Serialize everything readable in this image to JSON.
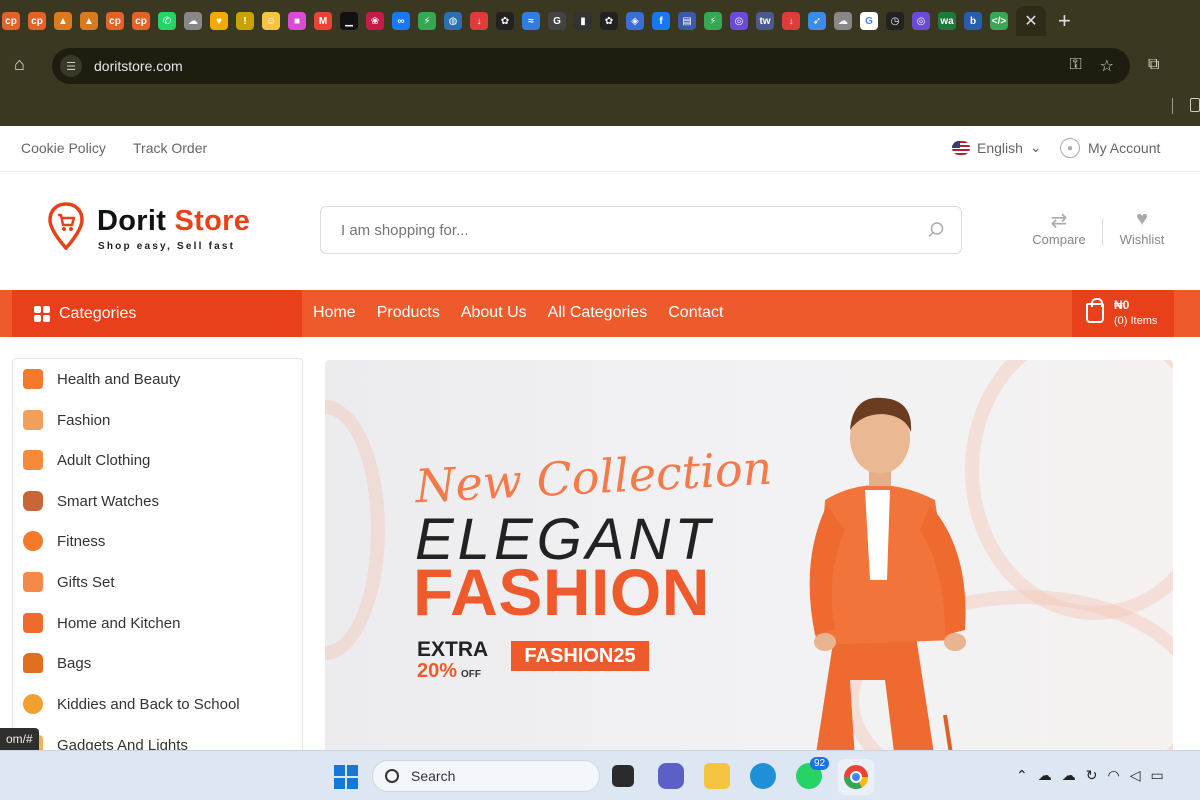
{
  "browser": {
    "active_tab_close": "✕",
    "new_tab": "+",
    "url": "doritstore.com",
    "favicons": [
      {
        "name": "cp-icon",
        "color": "#e3622a",
        "glyph": "cp"
      },
      {
        "name": "cp-icon",
        "color": "#e3622a",
        "glyph": "cp"
      },
      {
        "name": "triangle-icon",
        "color": "#d97a1e",
        "glyph": "▲"
      },
      {
        "name": "triangle-icon",
        "color": "#d97a1e",
        "glyph": "▲"
      },
      {
        "name": "cp-icon",
        "color": "#e3622a",
        "glyph": "cp"
      },
      {
        "name": "cp-icon",
        "color": "#e3622a",
        "glyph": "cp"
      },
      {
        "name": "whatsapp-icon",
        "color": "#25d366",
        "glyph": "✆"
      },
      {
        "name": "cloud-icon",
        "color": "#888",
        "glyph": "☁"
      },
      {
        "name": "heart-icon",
        "color": "#f2a900",
        "glyph": "♥"
      },
      {
        "name": "bookmark-icon",
        "color": "#c8a300",
        "glyph": "!"
      },
      {
        "name": "smile-icon",
        "color": "#f5c542",
        "glyph": "☺"
      },
      {
        "name": "grid-icon",
        "color": "#d84cd6",
        "glyph": "■"
      },
      {
        "name": "gmail-icon",
        "color": "#ea4335",
        "glyph": "M"
      },
      {
        "name": "chart-icon",
        "color": "#111",
        "glyph": "▁"
      },
      {
        "name": "raspberry-icon",
        "color": "#c51a4a",
        "glyph": "❀"
      },
      {
        "name": "meta-icon",
        "color": "#1877f2",
        "glyph": "∞"
      },
      {
        "name": "lightning-icon",
        "color": "#34a853",
        "glyph": "⚡"
      },
      {
        "name": "globe-icon",
        "color": "#2a6fb0",
        "glyph": "◍"
      },
      {
        "name": "download-icon",
        "color": "#e03b3b",
        "glyph": "↓"
      },
      {
        "name": "openai-icon",
        "color": "#222",
        "glyph": "✿"
      },
      {
        "name": "wave-icon",
        "color": "#2f7de1",
        "glyph": "≈"
      },
      {
        "name": "g-icon",
        "color": "#444",
        "glyph": "G"
      },
      {
        "name": "sound-icon",
        "color": "#333",
        "glyph": "▮"
      },
      {
        "name": "openai-icon",
        "color": "#222",
        "glyph": "✿"
      },
      {
        "name": "shield-icon",
        "color": "#3b6fd8",
        "glyph": "◈"
      },
      {
        "name": "facebook-icon",
        "color": "#1877f2",
        "glyph": "f"
      },
      {
        "name": "news-icon",
        "color": "#3b5aa8",
        "glyph": "▤"
      },
      {
        "name": "lightning-icon",
        "color": "#34a853",
        "glyph": "⚡"
      },
      {
        "name": "spiral-icon",
        "color": "#6a4ad8",
        "glyph": "◎"
      },
      {
        "name": "tw-icon",
        "color": "#4a5b8a",
        "glyph": "tw"
      },
      {
        "name": "download-icon",
        "color": "#e03b3b",
        "glyph": "↓"
      },
      {
        "name": "rocket-icon",
        "color": "#3b8be8",
        "glyph": "➶"
      },
      {
        "name": "cloud-icon",
        "color": "#888",
        "glyph": "☁"
      },
      {
        "name": "google-icon",
        "color": "#ffffff",
        "glyph": "G"
      },
      {
        "name": "clock-icon",
        "color": "#222",
        "glyph": "◷"
      },
      {
        "name": "spiral-icon",
        "color": "#6a4ad8",
        "glyph": "◎"
      },
      {
        "name": "wa-icon",
        "color": "#1e7a3a",
        "glyph": "wa"
      },
      {
        "name": "b-icon",
        "color": "#2a5db0",
        "glyph": "b"
      },
      {
        "name": "code-icon",
        "color": "#3aa657",
        "glyph": "</>"
      }
    ]
  },
  "topbar": {
    "cookie_policy": "Cookie Policy",
    "track_order": "Track Order",
    "language": "English",
    "account": "My Account"
  },
  "header": {
    "logo_main": "Dorit ",
    "logo_accent": "Store",
    "tagline": "Shop easy, Sell fast",
    "search_placeholder": "I am shopping for...",
    "compare": "Compare",
    "wishlist": "Wishlist"
  },
  "nav": {
    "categories": "Categories",
    "links": [
      "Home",
      "Products",
      "About Us",
      "All Categories",
      "Contact"
    ],
    "cart_amount": "₦0",
    "cart_items": "(0) Items"
  },
  "sidebar": {
    "items": [
      "Health and Beauty",
      "Fashion",
      "Adult Clothing",
      "Smart Watches",
      "Fitness",
      "Gifts Set",
      "Home and Kitchen",
      "Bags",
      "Kiddies and Back to School",
      "Gadgets And Lights"
    ]
  },
  "banner": {
    "new_collection": "New Collection",
    "elegant": "ELEGANT",
    "fashion": "FASHION",
    "extra": "EXTRA",
    "percent": "20%",
    "off": "OFF",
    "code": "FASHION25"
  },
  "status_url": "om/#",
  "taskbar": {
    "search": "Search",
    "whatsapp_badge": "92"
  },
  "colors": {
    "brand_orange": "#ef5a2c",
    "brand_dark_orange": "#e8401a"
  }
}
